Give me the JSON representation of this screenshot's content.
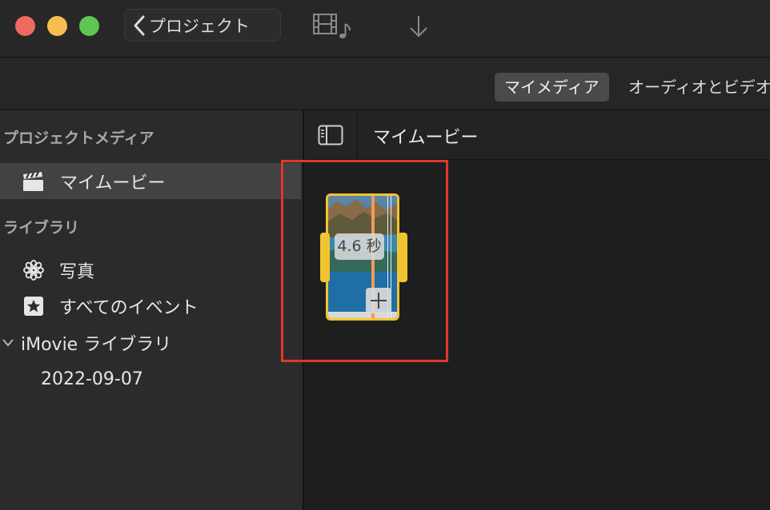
{
  "window": {
    "back_button_label": "プロジェクト",
    "toolbar_icons": [
      "film-music-icon",
      "download-arrow-icon"
    ]
  },
  "tabs": [
    {
      "label": "マイメディア",
      "selected": true
    },
    {
      "label": "オーディオとビデオ",
      "selected": false
    }
  ],
  "sidebar": {
    "project_media_header": "プロジェクトメディア",
    "project_items": [
      {
        "label": "マイムービー",
        "icon": "clapperboard-icon",
        "selected": true
      }
    ],
    "library_header": "ライブラリ",
    "library_items": [
      {
        "label": "写真",
        "icon": "photos-flower-icon"
      },
      {
        "label": "すべてのイベント",
        "icon": "star-icon"
      },
      {
        "label": "iMovie ライブラリ",
        "icon": "chevron-down-icon"
      },
      {
        "label": "2022-09-07"
      }
    ]
  },
  "browser": {
    "title": "マイムービー",
    "clip": {
      "duration_label": "4.6 秒",
      "add_button_glyph": "+"
    }
  },
  "colors": {
    "close": "#ed6a5e",
    "minimize": "#f5bf4f",
    "zoom": "#61c554",
    "clip_border": "#f2c530",
    "highlight_box": "#e0372b"
  }
}
